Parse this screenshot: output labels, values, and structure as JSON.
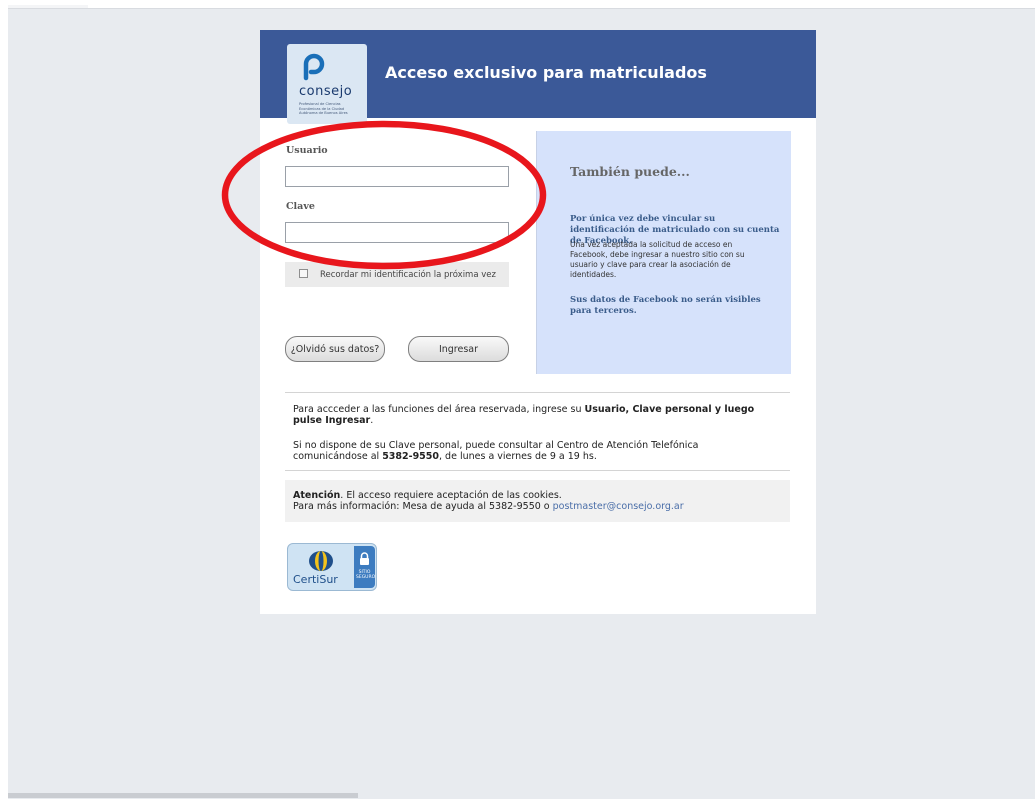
{
  "header": {
    "title": "Acceso exclusivo para matriculados",
    "brand_color": "#3b5998"
  },
  "logo": {
    "name": "consejo",
    "tagline": "Profesional de Ciencias Económicas de la Ciudad Autónoma de Buenos Aires",
    "icon": "consejo-logo-icon"
  },
  "form": {
    "usuario_label": "Usuario",
    "usuario_value": "",
    "clave_label": "Clave",
    "clave_value": "",
    "remember_label": "Recordar mi identificación la próxima vez",
    "forgot_button": "¿Olvidó sus datos?",
    "submit_button": "Ingresar"
  },
  "side_panel": {
    "heading": "También puede...",
    "bold_text": "Por única vez debe vincular su identificación de matriculado con su cuenta de Facebook.",
    "body_text": "Una vez aceptada la solicitud de acceso en Facebook, debe ingresar a nuestro sitio con su usuario y clave para crear la asociación de identidades.",
    "footer_text": "Sus datos de Facebook no serán visibles para terceros.",
    "background_color": "#d6e2fb"
  },
  "info": {
    "p1_text": "Para accceder a las funciones del área reservada, ingrese su ",
    "p1_bold": "Usuario, Clave personal y luego pulse Ingresar",
    "p1_end": ".",
    "p2_text": "Si no dispone de su Clave personal, puede consultar al Centro de Atención Telefónica comunicándose al ",
    "p2_bold": "5382-9550",
    "p2_end": ", de lunes a viernes de 9 a 19 hs."
  },
  "notice": {
    "bold": "Atención",
    "text": ". El acceso requiere aceptación de las cookies.",
    "line2": "Para más información: Mesa de ayuda al 5382-9550 o ",
    "email": "postmaster@consejo.org.ar"
  },
  "seal": {
    "brand": "CertiSur",
    "sub1": "SITIO",
    "sub2": "SEGURO"
  },
  "annotation": {
    "color": "#e8161c"
  }
}
